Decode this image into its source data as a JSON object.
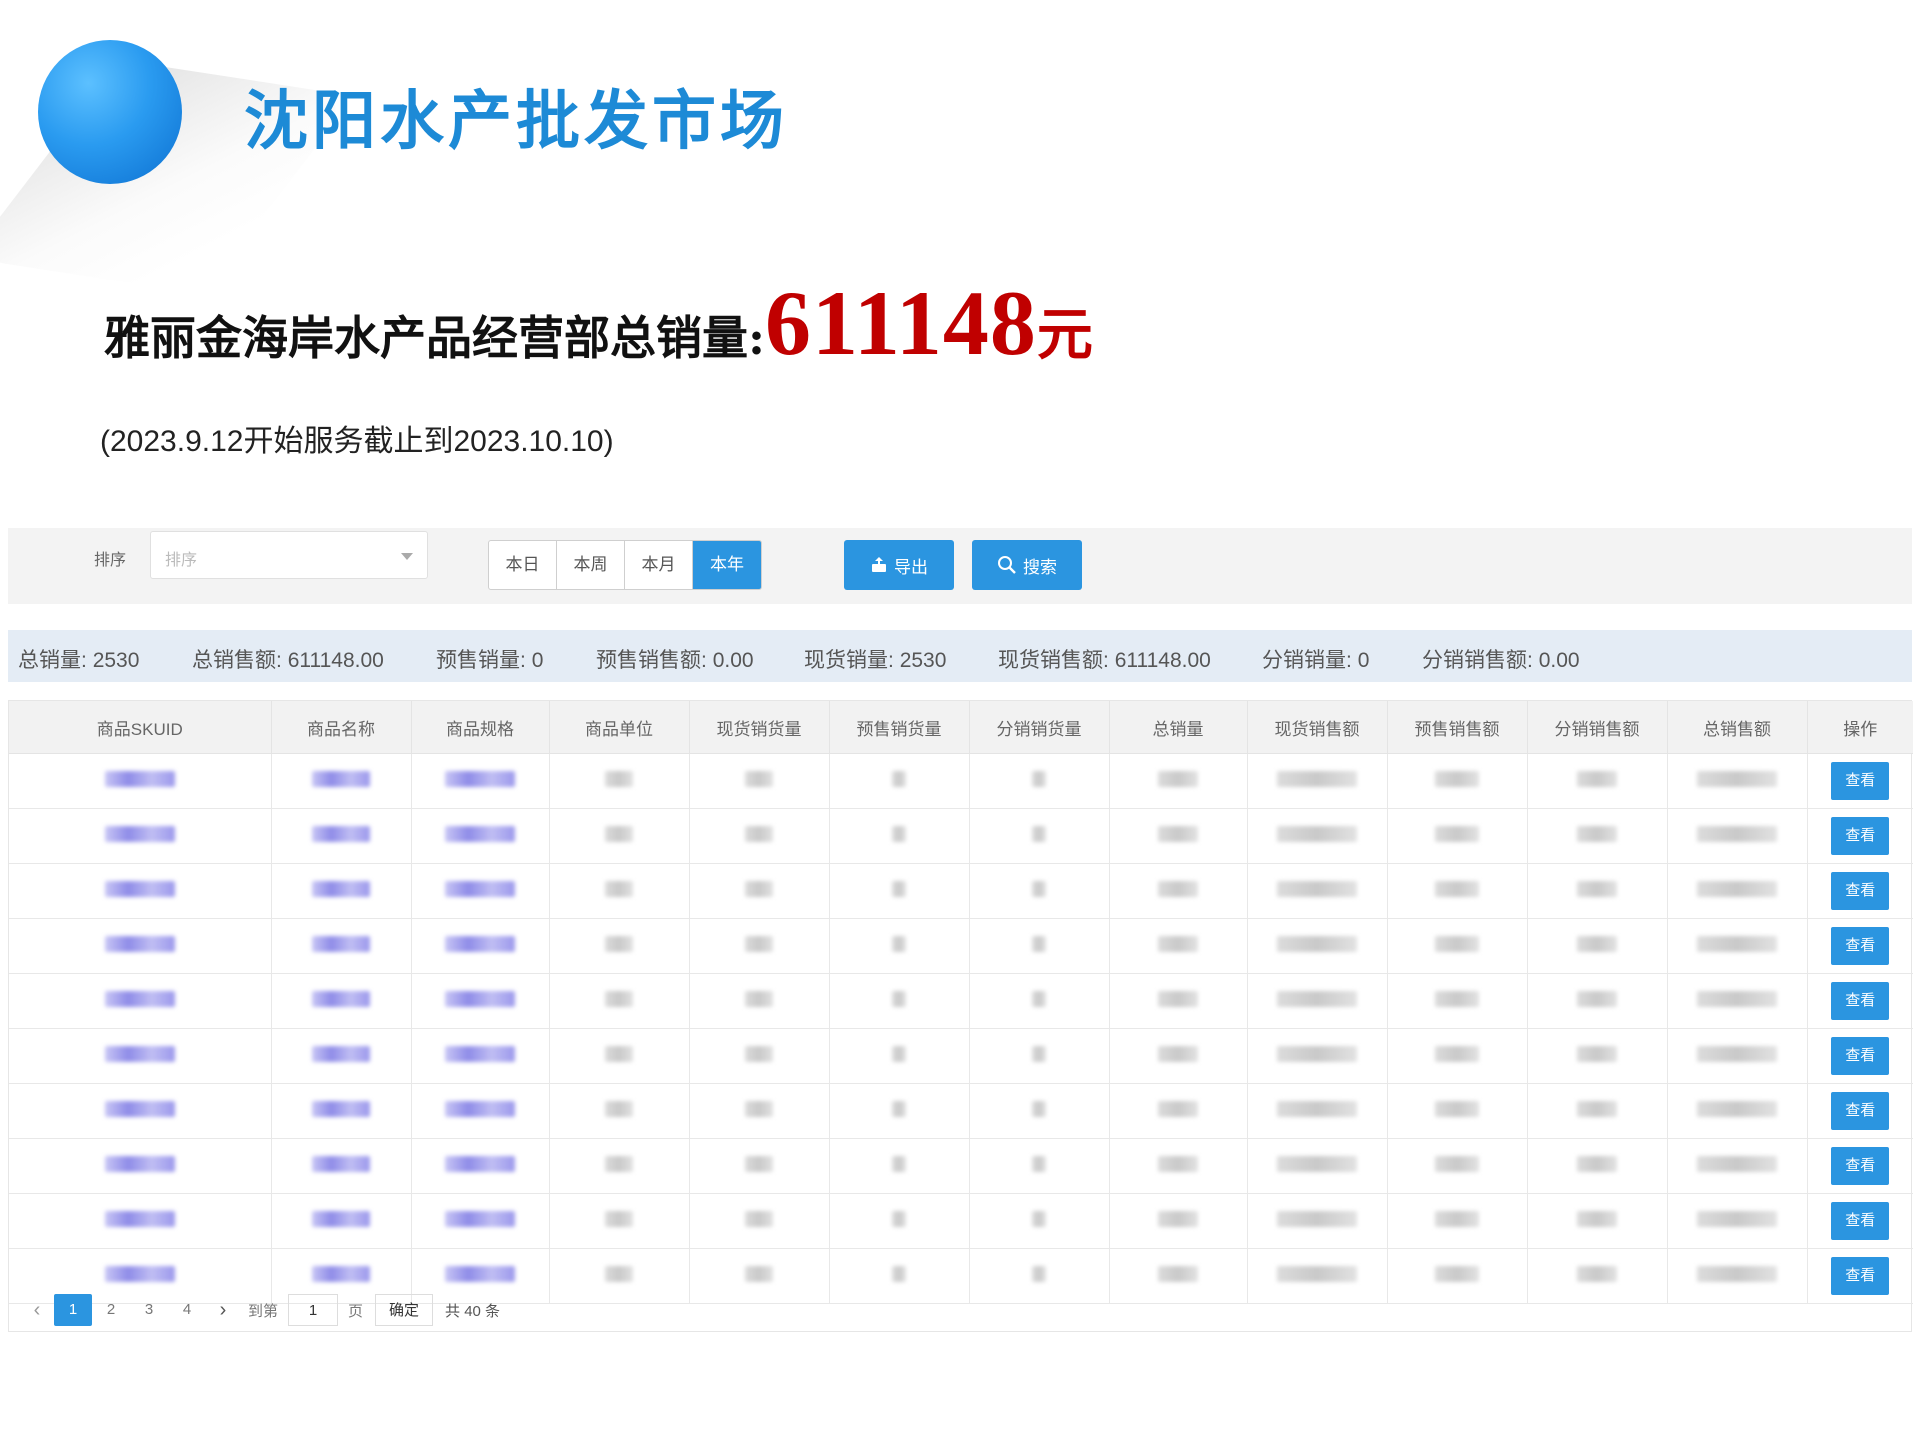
{
  "header": {
    "title": "沈阳水产批发市场",
    "headline_label": "雅丽金海岸水产品经营部总销量:",
    "headline_amount": "611148",
    "headline_unit": "元",
    "period": "(2023.9.12开始服务截止到2023.10.10)"
  },
  "filter": {
    "sort_label": "排序",
    "sort_placeholder": "排序",
    "ranges": [
      "本日",
      "本周",
      "本月",
      "本年"
    ],
    "active_range": "本年",
    "export_label": "导出",
    "search_label": "搜索"
  },
  "summary": [
    {
      "label": "总销量:",
      "value": "2530"
    },
    {
      "label": "总销售额:",
      "value": "611148.00"
    },
    {
      "label": "预售销量:",
      "value": "0"
    },
    {
      "label": "预售销售额:",
      "value": "0.00"
    },
    {
      "label": "现货销量:",
      "value": "2530"
    },
    {
      "label": "现货销售额:",
      "value": "611148.00"
    },
    {
      "label": "分销销量:",
      "value": "0"
    },
    {
      "label": "分销销售额:",
      "value": "0.00"
    }
  ],
  "table": {
    "columns": [
      "商品SKUID",
      "商品名称",
      "商品规格",
      "商品单位",
      "现货销货量",
      "预售销货量",
      "分销销货量",
      "总销量",
      "现货销售额",
      "预售销售额",
      "分销销售额",
      "总销售额",
      "操作"
    ],
    "row_action_label": "查看",
    "row_count": 10
  },
  "pagination": {
    "pages": [
      "1",
      "2",
      "3",
      "4"
    ],
    "current": "1",
    "goto_label": "到第",
    "goto_value": "1",
    "page_suffix": "页",
    "confirm_label": "确定",
    "total_label": "共 40 条"
  },
  "colors": {
    "title_blue": "#1d8ad6",
    "amount_red": "#c00000",
    "primary_button": "#2b95e0",
    "summary_bg": "#e4ecf5"
  },
  "icons": {
    "export": "export-icon",
    "search": "search-icon",
    "prev": "chevron-left-icon",
    "next": "chevron-right-icon",
    "dropdown": "caret-down-icon"
  }
}
